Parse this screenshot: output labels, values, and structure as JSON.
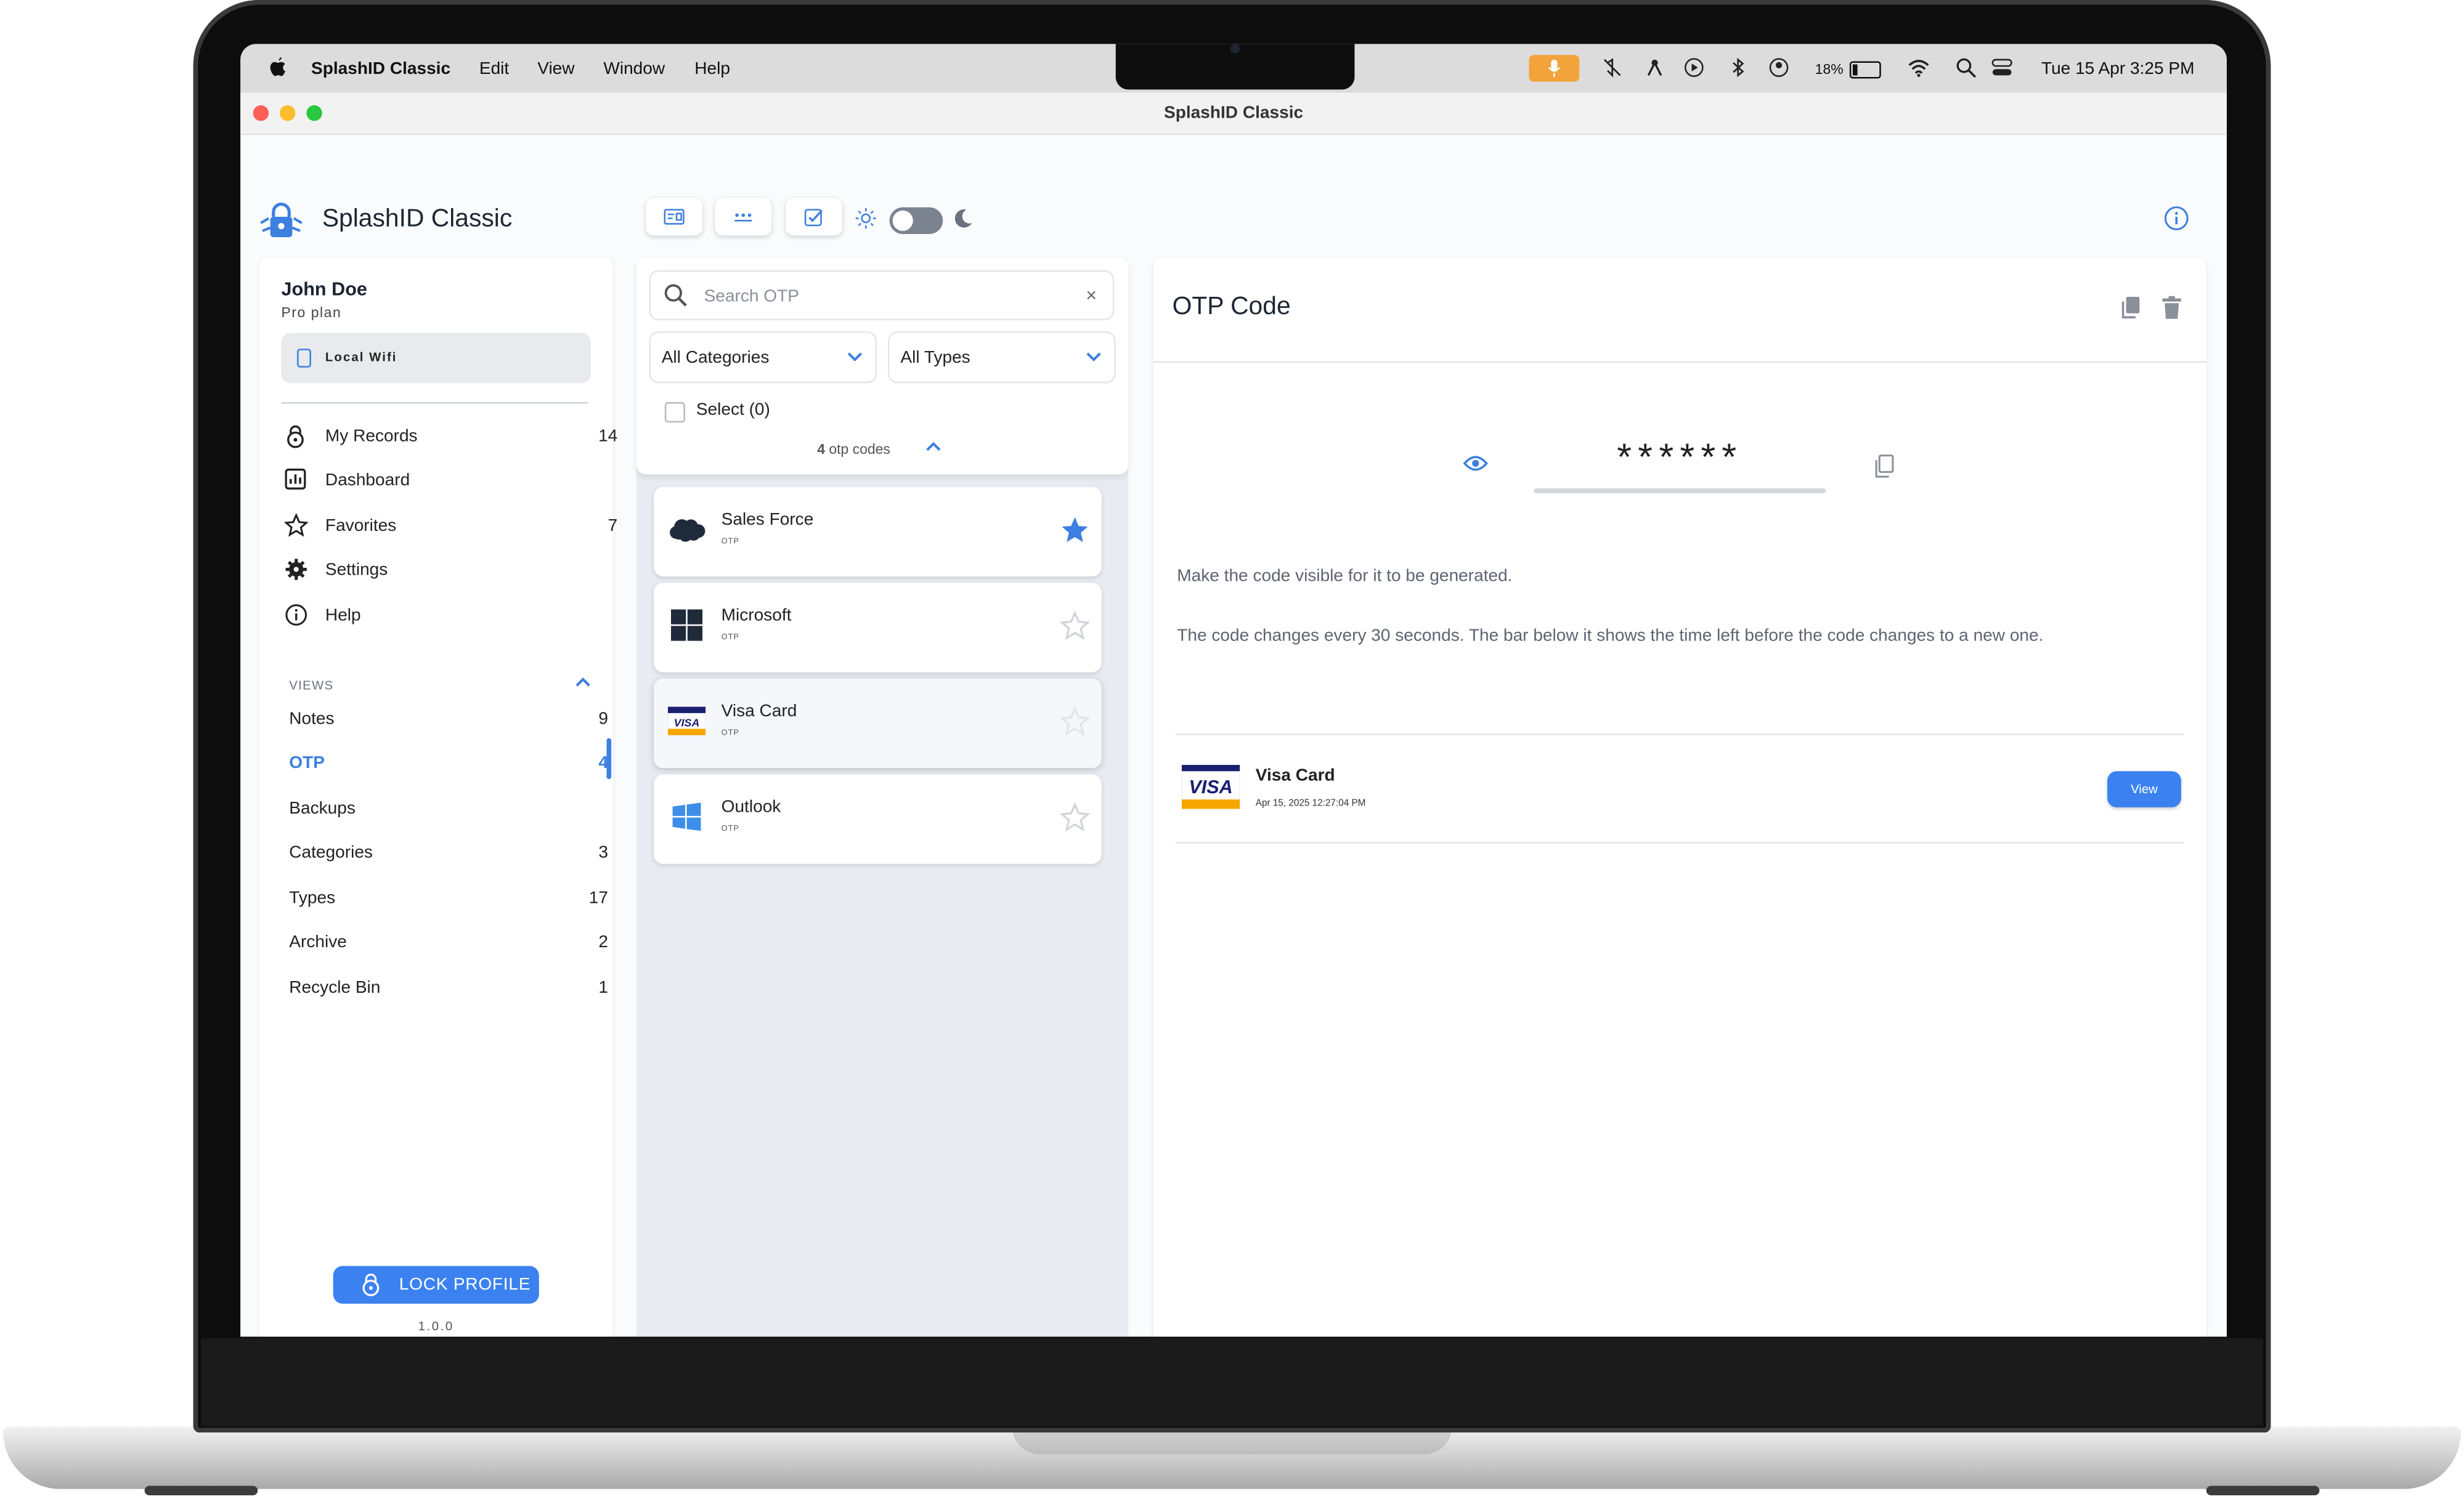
{
  "menubar": {
    "app_name": "SplashID Classic",
    "menus": [
      "Edit",
      "View",
      "Window",
      "Help"
    ],
    "battery": "18%",
    "datetime": "Tue 15 Apr  3:25 PM"
  },
  "window": {
    "title": "SplashID Classic"
  },
  "header": {
    "app_title": "SplashID Classic"
  },
  "sidebar": {
    "user_name": "John Doe",
    "plan": "Pro plan",
    "storage": "Local Wifi",
    "nav": [
      {
        "label": "My Records",
        "count": "14",
        "icon": "lock-icon"
      },
      {
        "label": "Dashboard",
        "count": "",
        "icon": "chart-icon"
      },
      {
        "label": "Favorites",
        "count": "7",
        "icon": "star-icon"
      },
      {
        "label": "Settings",
        "count": "",
        "icon": "gear-icon"
      },
      {
        "label": "Help",
        "count": "",
        "icon": "info-icon"
      }
    ],
    "views_heading": "VIEWS",
    "views": [
      {
        "label": "Notes",
        "count": "9"
      },
      {
        "label": "OTP",
        "count": "4"
      },
      {
        "label": "Backups",
        "count": ""
      },
      {
        "label": "Categories",
        "count": "3"
      },
      {
        "label": "Types",
        "count": "17"
      },
      {
        "label": "Archive",
        "count": "2"
      },
      {
        "label": "Recycle Bin",
        "count": "1"
      }
    ],
    "lock_label": "LOCK PROFILE",
    "version": "1.0.0"
  },
  "list": {
    "search_placeholder": "Search OTP",
    "clear": "×",
    "category_filter": "All Categories",
    "type_filter": "All Types",
    "select_label": "Select (0)",
    "count_number": "4",
    "count_suffix": " otp codes",
    "items": [
      {
        "name": "Sales Force",
        "type": "OTP",
        "favorite": true
      },
      {
        "name": "Microsoft",
        "type": "OTP",
        "favorite": false
      },
      {
        "name": "Visa Card",
        "type": "OTP",
        "favorite": false
      },
      {
        "name": "Outlook",
        "type": "OTP",
        "favorite": false
      }
    ]
  },
  "detail": {
    "title": "OTP Code",
    "code": "******",
    "note_visible": "Make the code visible for it to be generated.",
    "note_changes": "The code changes every 30 seconds. The bar below it shows the time left before the code changes to a new one.",
    "record_name": "Visa Card",
    "record_date": "Apr 15, 2025 12:27:04 PM",
    "view_label": "View",
    "visa_text": "VISA"
  },
  "colors": {
    "accent": "#3b82f0",
    "star_active": "#3d7fe0",
    "visa_blue": "#1a1f71",
    "visa_gold": "#f7a600",
    "mic_indicator": "#f2a33a"
  }
}
